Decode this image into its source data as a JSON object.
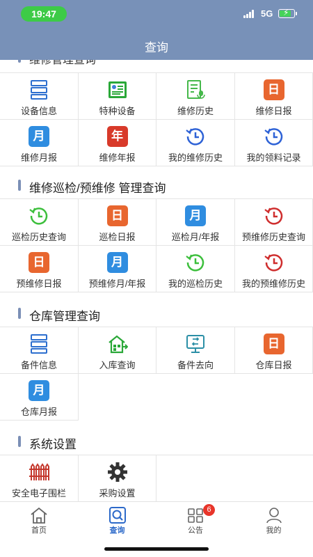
{
  "status": {
    "time": "19:47",
    "network": "5G"
  },
  "nav": {
    "title": "查询"
  },
  "partial_section_title": "维修管理查询",
  "sections": [
    {
      "title": "维修巡检/预维修 管理查询"
    },
    {
      "title": "仓库管理查询"
    },
    {
      "title": "系统设置"
    }
  ],
  "maintenance": {
    "items": [
      {
        "label": "设备信息",
        "icon": "server-list-icon"
      },
      {
        "label": "特种设备",
        "icon": "special-equipment-icon"
      },
      {
        "label": "维修历史",
        "icon": "maintenance-history-icon"
      },
      {
        "label": "维修日报",
        "icon": "daily-report-icon",
        "tile": "日"
      },
      {
        "label": "维修月报",
        "icon": "monthly-report-icon",
        "tile": "月"
      },
      {
        "label": "维修年报",
        "icon": "yearly-report-icon",
        "tile": "年"
      },
      {
        "label": "我的维修历史",
        "icon": "history-clock-icon"
      },
      {
        "label": "我的领料记录",
        "icon": "history-clock-icon"
      }
    ]
  },
  "inspection": {
    "items": [
      {
        "label": "巡检历史查询",
        "icon": "history-clock-icon"
      },
      {
        "label": "巡检日报",
        "icon": "daily-report-icon",
        "tile": "日"
      },
      {
        "label": "巡检月/年报",
        "icon": "monthly-report-icon",
        "tile": "月"
      },
      {
        "label": "预维修历史查询",
        "icon": "history-clock-icon"
      },
      {
        "label": "预维修日报",
        "icon": "daily-report-icon",
        "tile": "日"
      },
      {
        "label": "预维修月/年报",
        "icon": "monthly-report-icon",
        "tile": "月"
      },
      {
        "label": "我的巡检历史",
        "icon": "history-clock-icon"
      },
      {
        "label": "我的预维修历史",
        "icon": "history-clock-icon"
      }
    ]
  },
  "warehouse": {
    "items": [
      {
        "label": "备件信息",
        "icon": "server-list-icon"
      },
      {
        "label": "入库查询",
        "icon": "warehouse-in-icon"
      },
      {
        "label": "备件去向",
        "icon": "spare-destination-icon"
      },
      {
        "label": "仓库日报",
        "icon": "daily-report-icon",
        "tile": "日"
      },
      {
        "label": "仓库月报",
        "icon": "monthly-report-icon",
        "tile": "月"
      }
    ]
  },
  "system": {
    "items": [
      {
        "label": "安全电子围栏",
        "icon": "fence-icon"
      },
      {
        "label": "采购设置",
        "icon": "gear-icon"
      }
    ]
  },
  "tabbar": {
    "items": [
      {
        "label": "首页",
        "icon": "home-icon"
      },
      {
        "label": "查询",
        "icon": "query-icon"
      },
      {
        "label": "公告",
        "icon": "notice-grid-icon",
        "badge": "6"
      },
      {
        "label": "我的",
        "icon": "user-icon"
      }
    ]
  },
  "colors": {
    "header": "#7891b8",
    "accent_blue": "#2c69c9",
    "tile_orange": "#e8662f",
    "tile_blue": "#2f8de0",
    "tile_red": "#d83a2a",
    "clock_green": "#3dbf3d",
    "clock_blue": "#2e62d6",
    "clock_red": "#cf2e2e"
  }
}
